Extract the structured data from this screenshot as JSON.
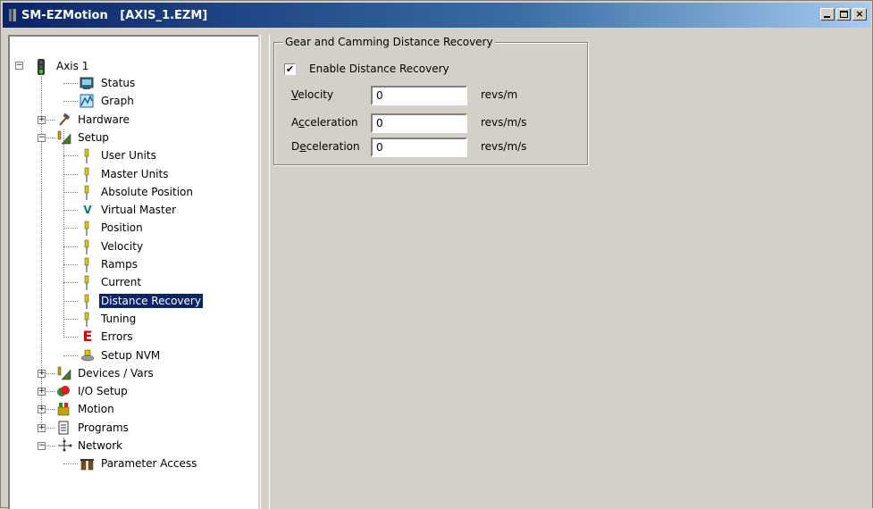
{
  "window": {
    "title": "SM-EZMotion   [AXIS_1.EZM]",
    "minimize_label": "_",
    "close_label": "×"
  },
  "tree": {
    "root": {
      "label": "Axis 1",
      "expander": "−"
    },
    "items": [
      {
        "label": "Status",
        "icon": "status-icon"
      },
      {
        "label": "Graph",
        "icon": "graph-icon"
      },
      {
        "label": "Hardware",
        "icon": "hammer-icon",
        "expander": "+"
      },
      {
        "label": "Setup",
        "icon": "setup-icon",
        "expander": "−"
      },
      {
        "label": "User Units",
        "icon": "plug-icon"
      },
      {
        "label": "Master Units",
        "icon": "plug-icon"
      },
      {
        "label": "Absolute Position",
        "icon": "plug-icon"
      },
      {
        "label": "Virtual Master",
        "icon": "virtual-master-icon",
        "glyph": "V"
      },
      {
        "label": "Position",
        "icon": "plug-icon"
      },
      {
        "label": "Velocity",
        "icon": "plug-icon"
      },
      {
        "label": "Ramps",
        "icon": "plug-icon"
      },
      {
        "label": "Current",
        "icon": "plug-icon"
      },
      {
        "label": "Distance Recovery",
        "icon": "plug-icon",
        "selected": true
      },
      {
        "label": "Tuning",
        "icon": "plug-icon"
      },
      {
        "label": "Errors",
        "icon": "errors-icon",
        "glyph": "E"
      },
      {
        "label": "Setup NVM",
        "icon": "nvm-icon"
      },
      {
        "label": "Devices / Vars",
        "icon": "devices-icon",
        "expander": "+"
      },
      {
        "label": "I/O Setup",
        "icon": "io-icon",
        "expander": "+"
      },
      {
        "label": "Motion",
        "icon": "motion-icon",
        "expander": "+"
      },
      {
        "label": "Programs",
        "icon": "programs-icon",
        "expander": "+"
      },
      {
        "label": "Network",
        "icon": "network-icon",
        "expander": "−"
      },
      {
        "label": "Parameter Access",
        "icon": "parameter-access-icon"
      }
    ]
  },
  "group": {
    "title": "Gear and Camming Distance Recovery",
    "enable_label": "Enable Distance Recovery",
    "enable_checked": "✔",
    "fields": [
      {
        "label_pre": "",
        "label_ul": "V",
        "label_post": "elocity",
        "value": "0",
        "unit": "revs/m"
      },
      {
        "label_pre": "A",
        "label_ul": "c",
        "label_post": "celeration",
        "value": "0",
        "unit": "revs/m/s"
      },
      {
        "label_pre": "D",
        "label_ul": "e",
        "label_post": "celeration",
        "value": "0",
        "unit": "revs/m/s"
      }
    ]
  },
  "colors": {
    "titlebar_start": "#0a246a",
    "titlebar_end": "#a6caf0",
    "selection": "#0a246a",
    "face": "#d4d0c8"
  }
}
